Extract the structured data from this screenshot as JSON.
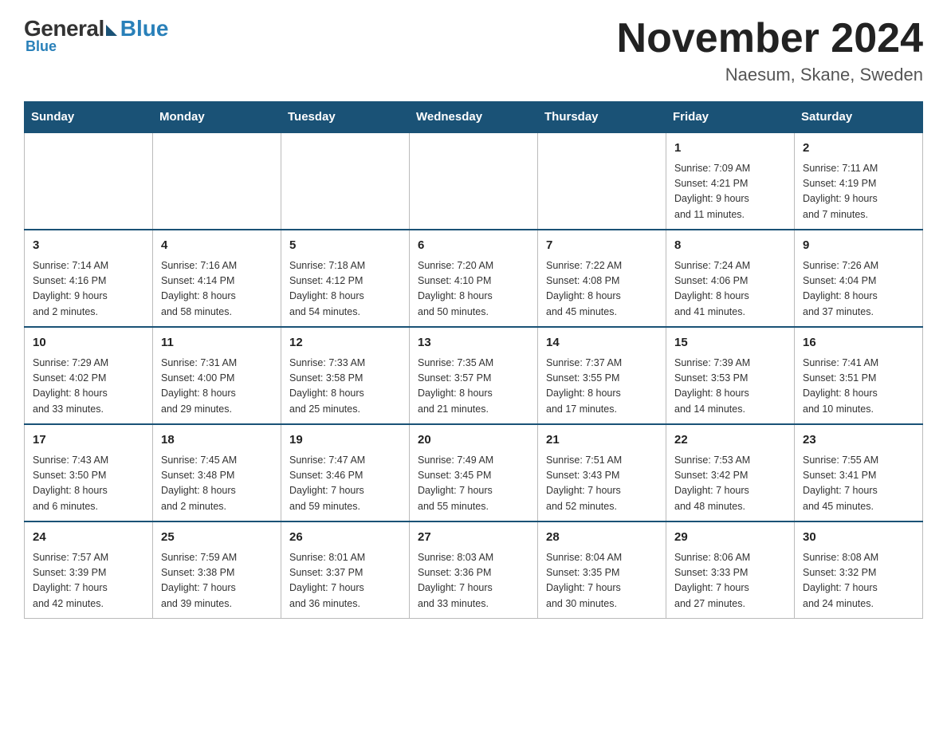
{
  "header": {
    "logo": {
      "general": "General",
      "blue": "Blue"
    },
    "title": "November 2024",
    "location": "Naesum, Skane, Sweden"
  },
  "weekdays": [
    "Sunday",
    "Monday",
    "Tuesday",
    "Wednesday",
    "Thursday",
    "Friday",
    "Saturday"
  ],
  "weeks": [
    [
      {
        "day": "",
        "info": ""
      },
      {
        "day": "",
        "info": ""
      },
      {
        "day": "",
        "info": ""
      },
      {
        "day": "",
        "info": ""
      },
      {
        "day": "",
        "info": ""
      },
      {
        "day": "1",
        "info": "Sunrise: 7:09 AM\nSunset: 4:21 PM\nDaylight: 9 hours\nand 11 minutes."
      },
      {
        "day": "2",
        "info": "Sunrise: 7:11 AM\nSunset: 4:19 PM\nDaylight: 9 hours\nand 7 minutes."
      }
    ],
    [
      {
        "day": "3",
        "info": "Sunrise: 7:14 AM\nSunset: 4:16 PM\nDaylight: 9 hours\nand 2 minutes."
      },
      {
        "day": "4",
        "info": "Sunrise: 7:16 AM\nSunset: 4:14 PM\nDaylight: 8 hours\nand 58 minutes."
      },
      {
        "day": "5",
        "info": "Sunrise: 7:18 AM\nSunset: 4:12 PM\nDaylight: 8 hours\nand 54 minutes."
      },
      {
        "day": "6",
        "info": "Sunrise: 7:20 AM\nSunset: 4:10 PM\nDaylight: 8 hours\nand 50 minutes."
      },
      {
        "day": "7",
        "info": "Sunrise: 7:22 AM\nSunset: 4:08 PM\nDaylight: 8 hours\nand 45 minutes."
      },
      {
        "day": "8",
        "info": "Sunrise: 7:24 AM\nSunset: 4:06 PM\nDaylight: 8 hours\nand 41 minutes."
      },
      {
        "day": "9",
        "info": "Sunrise: 7:26 AM\nSunset: 4:04 PM\nDaylight: 8 hours\nand 37 minutes."
      }
    ],
    [
      {
        "day": "10",
        "info": "Sunrise: 7:29 AM\nSunset: 4:02 PM\nDaylight: 8 hours\nand 33 minutes."
      },
      {
        "day": "11",
        "info": "Sunrise: 7:31 AM\nSunset: 4:00 PM\nDaylight: 8 hours\nand 29 minutes."
      },
      {
        "day": "12",
        "info": "Sunrise: 7:33 AM\nSunset: 3:58 PM\nDaylight: 8 hours\nand 25 minutes."
      },
      {
        "day": "13",
        "info": "Sunrise: 7:35 AM\nSunset: 3:57 PM\nDaylight: 8 hours\nand 21 minutes."
      },
      {
        "day": "14",
        "info": "Sunrise: 7:37 AM\nSunset: 3:55 PM\nDaylight: 8 hours\nand 17 minutes."
      },
      {
        "day": "15",
        "info": "Sunrise: 7:39 AM\nSunset: 3:53 PM\nDaylight: 8 hours\nand 14 minutes."
      },
      {
        "day": "16",
        "info": "Sunrise: 7:41 AM\nSunset: 3:51 PM\nDaylight: 8 hours\nand 10 minutes."
      }
    ],
    [
      {
        "day": "17",
        "info": "Sunrise: 7:43 AM\nSunset: 3:50 PM\nDaylight: 8 hours\nand 6 minutes."
      },
      {
        "day": "18",
        "info": "Sunrise: 7:45 AM\nSunset: 3:48 PM\nDaylight: 8 hours\nand 2 minutes."
      },
      {
        "day": "19",
        "info": "Sunrise: 7:47 AM\nSunset: 3:46 PM\nDaylight: 7 hours\nand 59 minutes."
      },
      {
        "day": "20",
        "info": "Sunrise: 7:49 AM\nSunset: 3:45 PM\nDaylight: 7 hours\nand 55 minutes."
      },
      {
        "day": "21",
        "info": "Sunrise: 7:51 AM\nSunset: 3:43 PM\nDaylight: 7 hours\nand 52 minutes."
      },
      {
        "day": "22",
        "info": "Sunrise: 7:53 AM\nSunset: 3:42 PM\nDaylight: 7 hours\nand 48 minutes."
      },
      {
        "day": "23",
        "info": "Sunrise: 7:55 AM\nSunset: 3:41 PM\nDaylight: 7 hours\nand 45 minutes."
      }
    ],
    [
      {
        "day": "24",
        "info": "Sunrise: 7:57 AM\nSunset: 3:39 PM\nDaylight: 7 hours\nand 42 minutes."
      },
      {
        "day": "25",
        "info": "Sunrise: 7:59 AM\nSunset: 3:38 PM\nDaylight: 7 hours\nand 39 minutes."
      },
      {
        "day": "26",
        "info": "Sunrise: 8:01 AM\nSunset: 3:37 PM\nDaylight: 7 hours\nand 36 minutes."
      },
      {
        "day": "27",
        "info": "Sunrise: 8:03 AM\nSunset: 3:36 PM\nDaylight: 7 hours\nand 33 minutes."
      },
      {
        "day": "28",
        "info": "Sunrise: 8:04 AM\nSunset: 3:35 PM\nDaylight: 7 hours\nand 30 minutes."
      },
      {
        "day": "29",
        "info": "Sunrise: 8:06 AM\nSunset: 3:33 PM\nDaylight: 7 hours\nand 27 minutes."
      },
      {
        "day": "30",
        "info": "Sunrise: 8:08 AM\nSunset: 3:32 PM\nDaylight: 7 hours\nand 24 minutes."
      }
    ]
  ]
}
